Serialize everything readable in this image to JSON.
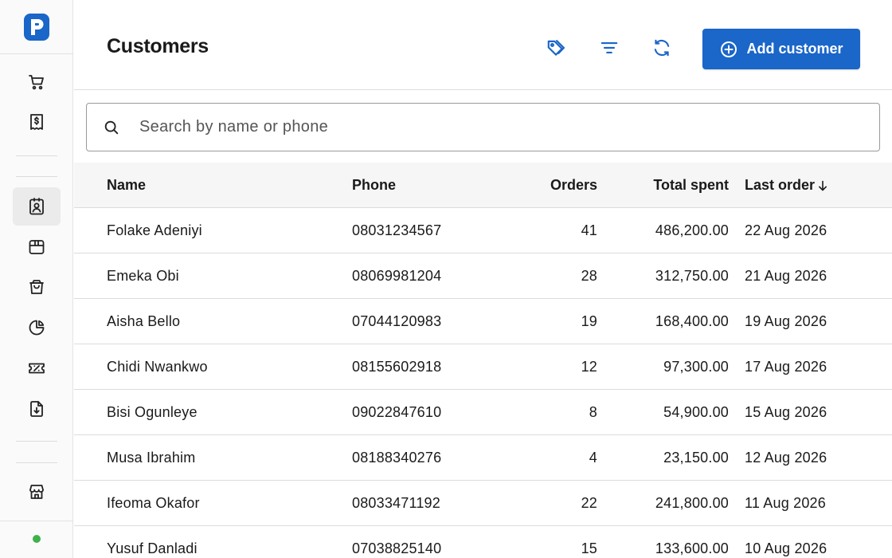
{
  "app": {
    "logo_letter": "p",
    "accent": "#1a66c9",
    "status_color": "#3eb24a"
  },
  "sidebar": {
    "items": [
      {
        "icon": "cart-icon",
        "active": false
      },
      {
        "icon": "receipt-icon",
        "active": false
      },
      {
        "icon": "customers-icon",
        "active": true
      },
      {
        "icon": "box-icon",
        "active": false
      },
      {
        "icon": "bag-icon",
        "active": false
      },
      {
        "icon": "pie-chart-icon",
        "active": false
      },
      {
        "icon": "ticket-icon",
        "active": false
      },
      {
        "icon": "file-download-icon",
        "active": false
      },
      {
        "icon": "store-icon",
        "active": false
      }
    ]
  },
  "header": {
    "title": "Customers",
    "icons": [
      "tag-icon",
      "filter-icon",
      "refresh-icon"
    ],
    "add_label": "Add customer"
  },
  "search": {
    "placeholder": "Search by name or phone",
    "value": ""
  },
  "table": {
    "columns": {
      "name": "Name",
      "phone": "Phone",
      "orders": "Orders",
      "total": "Total spent",
      "last": "Last order"
    },
    "sort": {
      "column": "last",
      "direction": "desc"
    },
    "rows": [
      {
        "name": "Folake Adeniyi",
        "phone": "08031234567",
        "orders": "41",
        "total": "486,200.00",
        "last": "22 Aug 2026"
      },
      {
        "name": "Emeka Obi",
        "phone": "08069981204",
        "orders": "28",
        "total": "312,750.00",
        "last": "21 Aug 2026"
      },
      {
        "name": "Aisha Bello",
        "phone": "07044120983",
        "orders": "19",
        "total": "168,400.00",
        "last": "19 Aug 2026"
      },
      {
        "name": "Chidi Nwankwo",
        "phone": "08155602918",
        "orders": "12",
        "total": "97,300.00",
        "last": "17 Aug 2026"
      },
      {
        "name": "Bisi Ogunleye",
        "phone": "09022847610",
        "orders": "8",
        "total": "54,900.00",
        "last": "15 Aug 2026"
      },
      {
        "name": "Musa Ibrahim",
        "phone": "08188340276",
        "orders": "4",
        "total": "23,150.00",
        "last": "12 Aug 2026"
      },
      {
        "name": "Ifeoma Okafor",
        "phone": "08033471192",
        "orders": "22",
        "total": "241,800.00",
        "last": "11 Aug 2026"
      },
      {
        "name": "Yusuf Danladi",
        "phone": "07038825140",
        "orders": "15",
        "total": "133,600.00",
        "last": "10 Aug 2026"
      }
    ]
  }
}
